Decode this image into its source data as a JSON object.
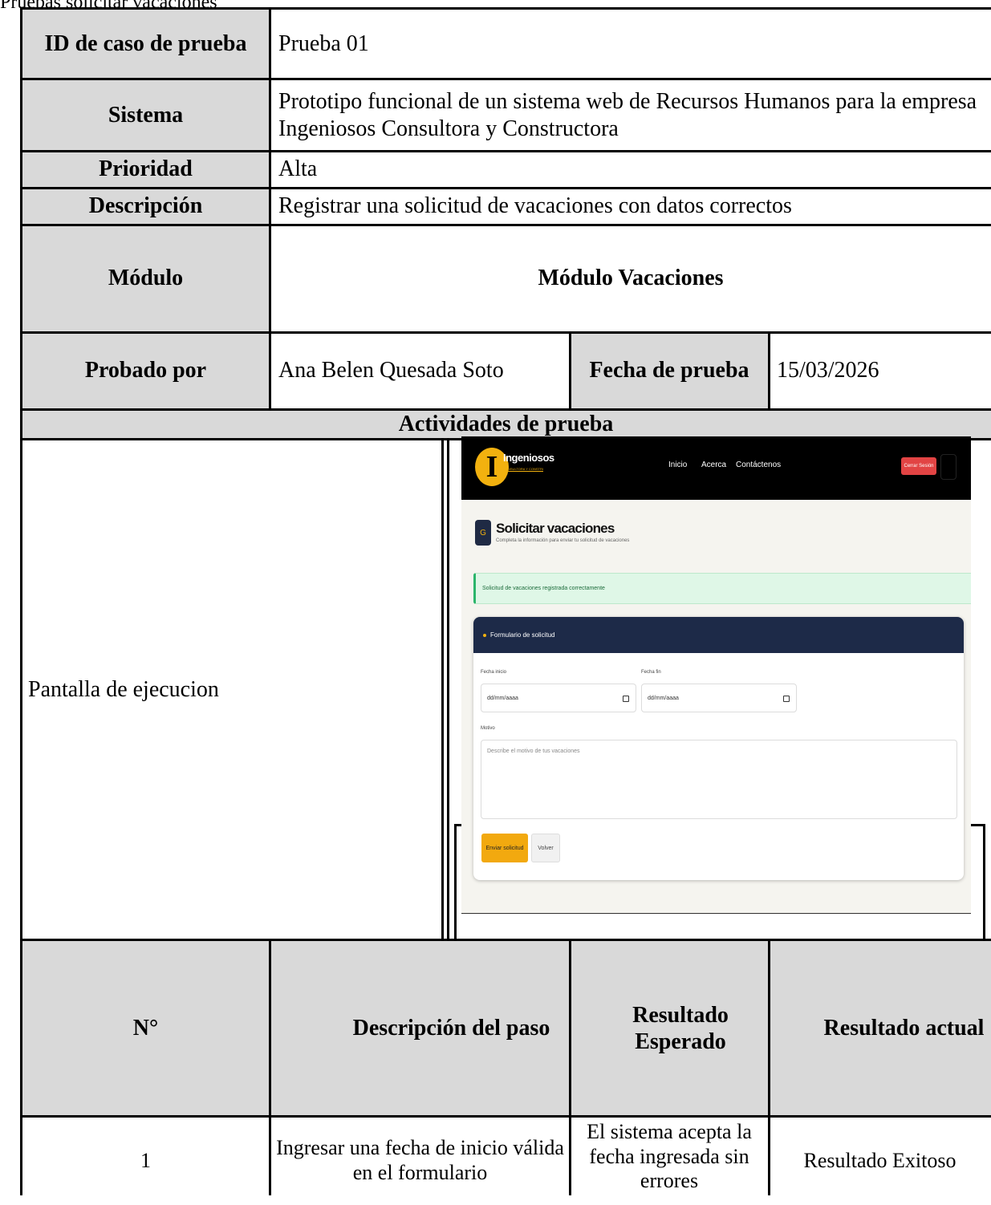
{
  "doc_title": "Pruebas solicitar vacaciones",
  "table": {
    "test_id_label": "ID de caso de prueba",
    "test_id_value": "Prueba 01",
    "system_label": "Sistema",
    "system_value": "Prototipo funcional de un sistema web de Recursos Humanos para la empresa Ingeniosos Consultora y Constructora",
    "priority_label": "Prioridad",
    "priority_value": "Alta",
    "description_label": "Descripción",
    "description_value": "Registrar una solicitud de vacaciones con datos correctos",
    "module_label": "Módulo",
    "module_value": "Módulo Vacaciones",
    "tested_by_label": "Probado por",
    "tested_by_value": "Ana Belen Quesada Soto",
    "test_date_label": "Fecha de prueba",
    "test_date_value": "15/03/2026",
    "activities_label": "Actividades de prueba",
    "execution_screen_label": "Pantalla de ejecucion",
    "steps_headers": {
      "number": "N°",
      "step_description": "Descripción del paso",
      "expected": "Resultado Esperado",
      "actual": "Resultado actual"
    },
    "steps": [
      {
        "number": "1",
        "description": "Ingresar una fecha de inicio válida en el formulario",
        "expected": "El sistema acepta la fecha ingresada sin errores",
        "actual": "Resultado Exitoso"
      }
    ]
  },
  "screenshot": {
    "brand": "Ingeniosos",
    "brand_subtitle": "CONSULTORA Y CONSTRUCTORA",
    "nav": [
      "Inicio",
      "Acerca",
      "Contáctenos"
    ],
    "logout": "Cerrar Sesión",
    "page_title": "Solicitar vacaciones",
    "page_subtitle": "Completa la información para enviar tu solicitud de vacaciones",
    "alert": "Solicitud de vacaciones registrada correctamente",
    "form_title": "Formulario de solicitud",
    "start_label": "Fecha inicio",
    "start_placeholder": "dd/mm/aaaa",
    "end_label": "Fecha fin",
    "end_placeholder": "dd/mm/aaaa",
    "reason_label": "Motivo",
    "reason_placeholder": "Describe el motivo de tus vacaciones",
    "submit": "Enviar solicitud",
    "back": "Volver",
    "colors": {
      "navbar": "#000000",
      "accent": "#f2b10f",
      "logout": "#e24444",
      "card_header": "#1d2a48",
      "alert_bg": "#dff7e7"
    }
  }
}
